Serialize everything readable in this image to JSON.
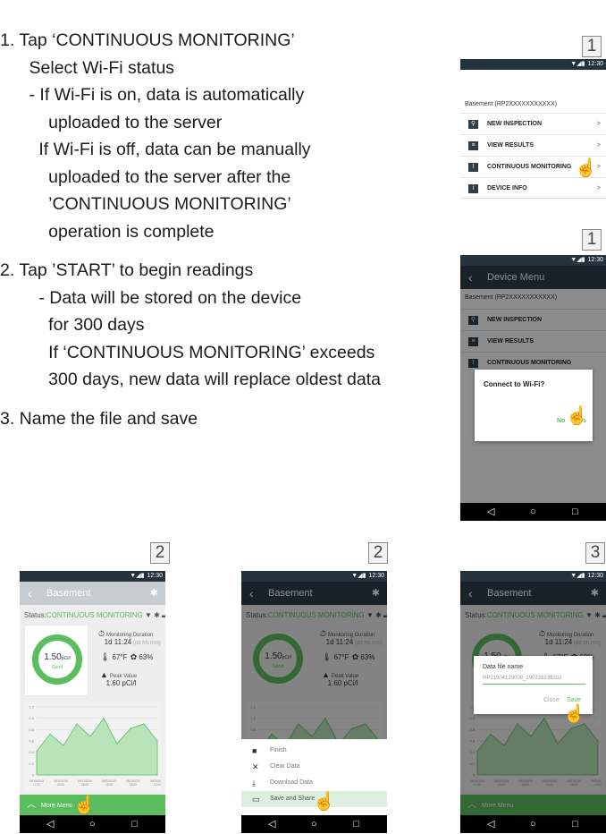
{
  "instructions": {
    "lines": [
      "1. Tap ‘CONTINUOUS MONITORING’",
      "   Select Wi-Fi status",
      "   - If Wi-Fi is on, data is automatically",
      "     uploaded to the server",
      "    If Wi-Fi is off, data can be manually",
      "     uploaded to the server after the",
      "     ’CONTINUOUS MONITORING’",
      "     operation is complete",
      "",
      "2. Tap ’START’ to begin readings",
      "    - Data will be stored on the device",
      "     for 300 days",
      "     If ‘CONTINUOUS MONITORING’ exceeds",
      "     300 days, new data will replace oldest data",
      "",
      "3. Name the file and save"
    ]
  },
  "step_badges": [
    "1",
    "1",
    "2",
    "2",
    "3"
  ],
  "status_bar": {
    "time": "12:30",
    "icons": "▼◢▮"
  },
  "nav_bar": {
    "back": "◁",
    "home": "○",
    "recent": "□"
  },
  "device_menu": {
    "title": "Device Menu",
    "device_label": "Basement (RP2XXXXXXXXXXX)",
    "items": [
      {
        "label": "NEW INSPECTION",
        "icon": "search-icon",
        "glyph": "⚲"
      },
      {
        "label": "VIEW RESULTS",
        "icon": "list-icon",
        "glyph": "≡"
      },
      {
        "label": "CONTINUOUS MONITORING",
        "icon": "pulse-icon",
        "glyph": "⌇"
      },
      {
        "label": "DEVICE INFO",
        "icon": "info-icon",
        "glyph": "i"
      }
    ],
    "chevron": ">"
  },
  "wifi_dialog": {
    "title": "Connect to Wi-Fi?",
    "no": "No",
    "yes": "Yes"
  },
  "monitor": {
    "title": "Basement",
    "status_prefix": "Status:",
    "status_value": "CONTINUOUS MONITORING",
    "status_icons": "▼ ✱ ▬",
    "reading_value": "1.50",
    "reading_unit": "pCi/l",
    "reading_quality": "Good",
    "duration_label": "Monitoring Duration",
    "duration_value": "1d 11:24",
    "duration_unit": "(dd hh:mm)",
    "temperature": "67°F",
    "humidity": "63%",
    "peak_label": "Peak Value",
    "peak_value": "1.60 pCi/l",
    "more_menu": "More Menu",
    "accent": "#5bbd5d",
    "appbar_color": "#2d3e4a"
  },
  "chart_data": {
    "type": "area",
    "y_ticks": [
      "0",
      "0.2",
      "0.4",
      "0.6",
      "0.8",
      "1.0",
      "1.2"
    ],
    "x_ticks": [
      "09/19/2019 17:00",
      "09/20/2019 20:00",
      "09/21/2019 08:00",
      "09/22/2019 13:00",
      "09/23/2019 18:00",
      "09/24/2019 12:00"
    ],
    "values": [
      0.42,
      0.72,
      0.52,
      0.9,
      0.68,
      1.0,
      0.55,
      0.82,
      0.9,
      0.6
    ],
    "ylim": [
      0,
      1.2
    ],
    "color": "#5bbd5d"
  },
  "more_sheet": {
    "items": [
      {
        "label": "Finish",
        "icon": "stop-icon",
        "glyph": "■"
      },
      {
        "label": "Clear Data",
        "icon": "close-icon",
        "glyph": "✕"
      },
      {
        "label": "Download Data",
        "icon": "download-icon",
        "glyph": "⤓"
      },
      {
        "label": "Save and Share",
        "icon": "folder-icon",
        "glyph": "▭"
      }
    ]
  },
  "file_dialog": {
    "title": "Data file name",
    "value": "RP21904129008_190228135102",
    "close": "Close",
    "save": "Save"
  }
}
